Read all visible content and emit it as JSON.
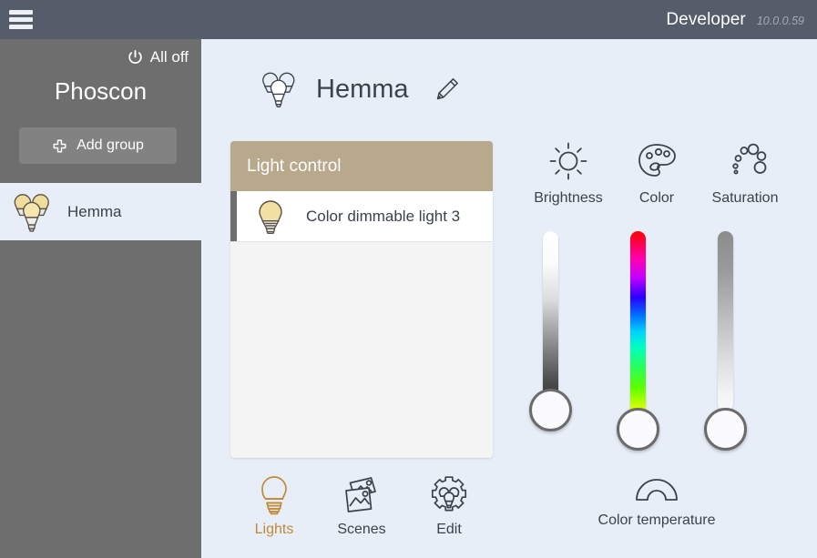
{
  "topbar": {
    "menu_icon": "hamburger-icon",
    "user_label": "Developer",
    "ip_address": "10.0.0.59"
  },
  "sidebar": {
    "all_off_label": "All off",
    "all_off_icon": "power-icon",
    "brand": "Phoscon",
    "add_group_label": "Add group",
    "add_group_icon": "plus-icon",
    "groups": [
      {
        "label": "Hemma",
        "icon": "bulbs-icon",
        "selected": true
      }
    ]
  },
  "main": {
    "group": {
      "name": "Hemma",
      "icon": "bulbs-outline-icon",
      "edit_icon": "pencil-icon"
    },
    "light_control": {
      "title": "Light control",
      "lights": [
        {
          "name": "Color dimmable light 3",
          "icon": "bulb-on-icon",
          "selected": true
        }
      ]
    },
    "tabs": [
      {
        "label": "Lights",
        "icon": "bulb-outline-icon",
        "active": true
      },
      {
        "label": "Scenes",
        "icon": "photos-icon",
        "active": false
      },
      {
        "label": "Edit",
        "icon": "gear-bulbs-icon",
        "active": false
      }
    ],
    "controls": [
      {
        "label": "Brightness",
        "icon": "sun-icon"
      },
      {
        "label": "Color",
        "icon": "palette-icon"
      },
      {
        "label": "Saturation",
        "icon": "saturation-dots-icon"
      }
    ],
    "color_temperature": {
      "label": "Color temperature",
      "icon": "color-temperature-arc-icon"
    }
  },
  "colors": {
    "topbar": "#555d6b",
    "sidebar": "#6e6e6e",
    "background": "#e8eef7",
    "card_header": "#b8a88c",
    "accent_active_tab": "#c08a39",
    "text_dark": "#3b424d"
  }
}
